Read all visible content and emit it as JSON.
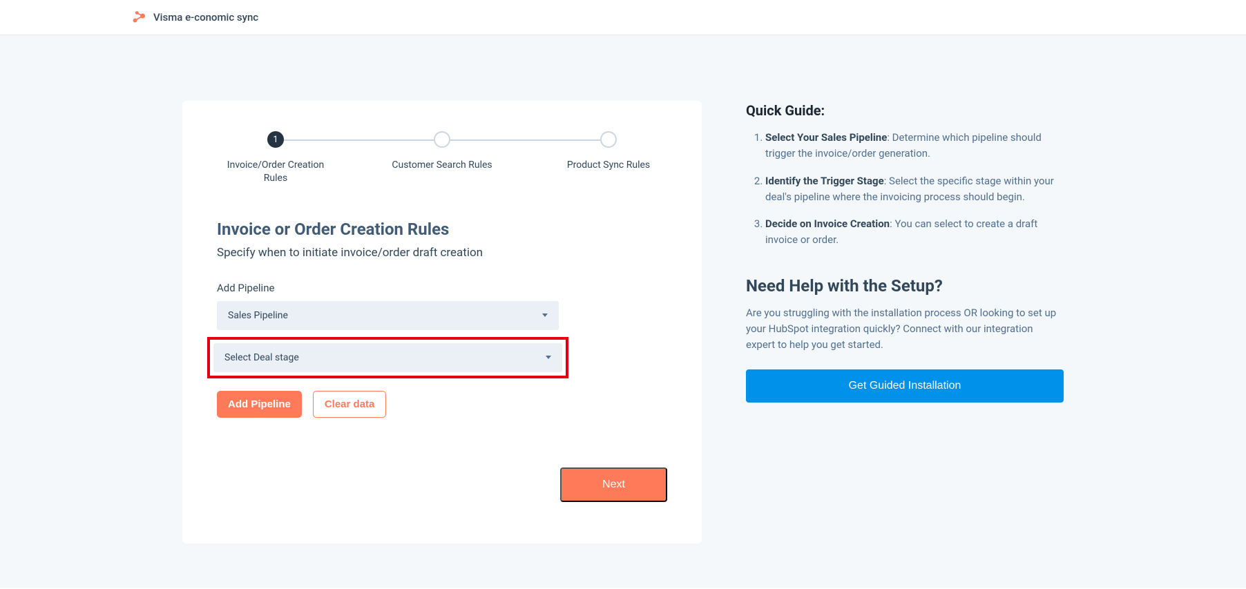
{
  "header": {
    "title": "Visma e-conomic sync"
  },
  "stepper": {
    "steps": [
      {
        "num": "1",
        "label": "Invoice/Order Creation Rules",
        "active": true
      },
      {
        "num": "",
        "label": "Customer Search Rules",
        "active": false
      },
      {
        "num": "",
        "label": "Product Sync Rules",
        "active": false
      }
    ]
  },
  "main": {
    "title": "Invoice or Order Creation Rules",
    "subtitle": "Specify when to initiate invoice/order draft creation",
    "field_label": "Add Pipeline",
    "pipeline_select_value": "Sales Pipeline",
    "stage_select_value": "Select Deal stage",
    "add_pipeline_btn": "Add Pipeline",
    "clear_data_btn": "Clear data",
    "next_btn": "Next"
  },
  "guide": {
    "title": "Quick Guide:",
    "items": [
      {
        "bold": "Select Your Sales Pipeline",
        "text": ": Determine which pipeline should trigger the invoice/order generation."
      },
      {
        "bold": "Identify the Trigger Stage",
        "text": ": Select the specific stage within your deal's pipeline where the invoicing process should begin."
      },
      {
        "bold": "Decide on Invoice Creation",
        "text": ": You can select to create a draft invoice or order."
      }
    ]
  },
  "help": {
    "title": "Need Help with the Setup?",
    "text": "Are you struggling with the installation process OR looking to set up your HubSpot integration quickly? Connect with our integration expert to help you get started.",
    "button": "Get Guided Installation"
  }
}
